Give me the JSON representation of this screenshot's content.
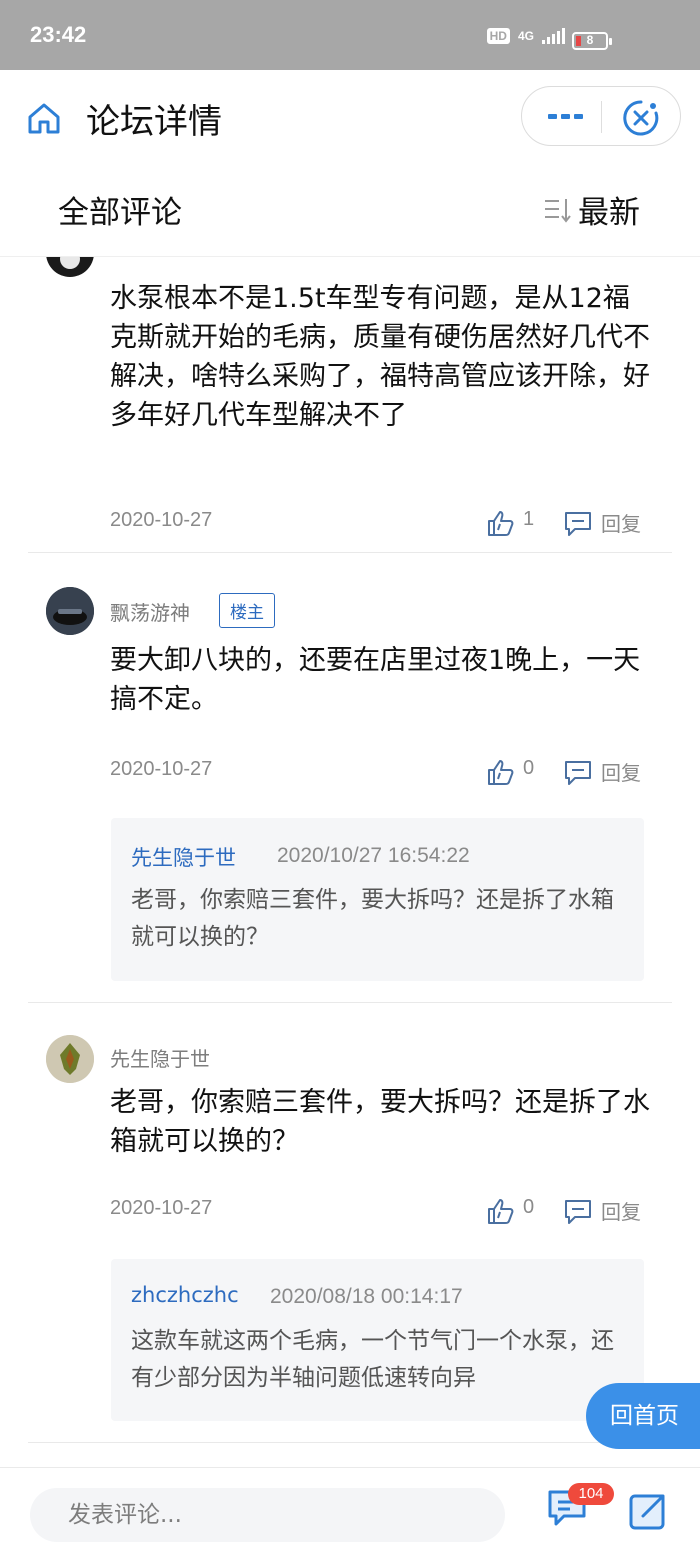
{
  "status_bar": {
    "time": "23:42",
    "hd": "HD",
    "network": "4G",
    "battery": "8"
  },
  "header": {
    "title": "论坛详情",
    "home_icon": "home-icon",
    "more_icon": "more-icon",
    "close_icon": "close-icon"
  },
  "sort_bar": {
    "title": "全部评论",
    "sort_label": "最新",
    "sort_icon": "sort-icon"
  },
  "comments": [
    {
      "content": "水泵根本不是1.5t车型专有问题，是从12福克斯就开始的毛病，质量有硬伤居然好几代不解决，啥特么采购了，福特高管应该开除，好多年好几代车型解决不了",
      "date": "2020-10-27",
      "likes": "1",
      "reply_label": "回复"
    },
    {
      "user": "飘荡游神",
      "badge": "楼主",
      "content": "要大卸八块的，还要在店里过夜1晚上，一天搞不定。",
      "date": "2020-10-27",
      "likes": "0",
      "reply_label": "回复",
      "quote": {
        "user": "先生隐于世",
        "time": "2020/10/27 16:54:22",
        "text": "老哥，你索赔三套件，要大拆吗？还是拆了水箱就可以换的？"
      }
    },
    {
      "user": "先生隐于世",
      "content": "老哥，你索赔三套件，要大拆吗？还是拆了水箱就可以换的？",
      "date": "2020-10-27",
      "likes": "0",
      "reply_label": "回复",
      "quote": {
        "user": "zhczhczhc",
        "time": "2020/08/18 00:14:17",
        "text": "这款车就这两个毛病，一个节气门一个水泵，还有少部分因为半轴问题低速转向异"
      }
    }
  ],
  "floating": {
    "back_home": "回首页"
  },
  "bottom_bar": {
    "input_placeholder": "发表评论...",
    "comment_count": "104"
  },
  "colors": {
    "accent": "#2d6bbf",
    "floating_button": "#3b90e8",
    "badge_red": "#ef4a3c",
    "status_bar": "#a7a7a7"
  }
}
